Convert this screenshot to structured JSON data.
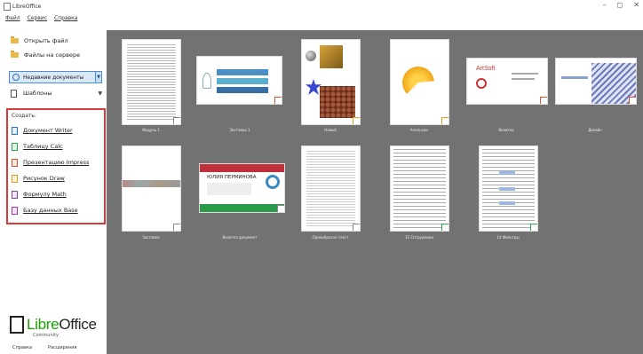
{
  "window": {
    "title": "LibreOffice",
    "controls": [
      "–",
      "◻",
      "✕"
    ]
  },
  "menu": [
    "Файл",
    "Сервис",
    "Справка"
  ],
  "sidebar": {
    "open_file": "Открыть файл",
    "remote_files": "Файлы на сервере",
    "recent_documents": "Недавние документы",
    "templates": "Шаблоны",
    "create_heading": "Создать:",
    "create_items": [
      {
        "label": "Документ Writer",
        "color": "#2a77c9"
      },
      {
        "label": "Таблицу Calc",
        "color": "#2aa34a"
      },
      {
        "label": "Презентацию Impress",
        "color": "#d9532c"
      },
      {
        "label": "Рисунок Draw",
        "color": "#e0a020"
      },
      {
        "label": "Формулу Math",
        "color": "#7a4aa0"
      },
      {
        "label": "Базу данных Base",
        "color": "#a33aa0"
      }
    ],
    "logo": {
      "libre": "Libre",
      "office": "Office",
      "community": "Community"
    },
    "bottom_links": [
      "Справка",
      "Расширения"
    ]
  },
  "recent": [
    {
      "caption": "Модуль 1"
    },
    {
      "caption": "Заставка 1"
    },
    {
      "caption": "Новый"
    },
    {
      "caption": "Апельсин"
    },
    {
      "caption": "Визитка"
    },
    {
      "caption": "Дизайн"
    },
    {
      "caption": "Заставка"
    },
    {
      "caption": "Визитка документ"
    },
    {
      "caption": "Однообразно текст"
    },
    {
      "caption": "11 Сотрудники"
    },
    {
      "caption": "14 Фильтры"
    }
  ],
  "thumb_text": {
    "artsoft": "ArtSoft",
    "card_name": "ЮЛИЯ ПЕРМИНОВА"
  },
  "colors": {
    "accent": "#d63a3a",
    "main_bg": "#727272",
    "logo_green": "#18a303"
  }
}
